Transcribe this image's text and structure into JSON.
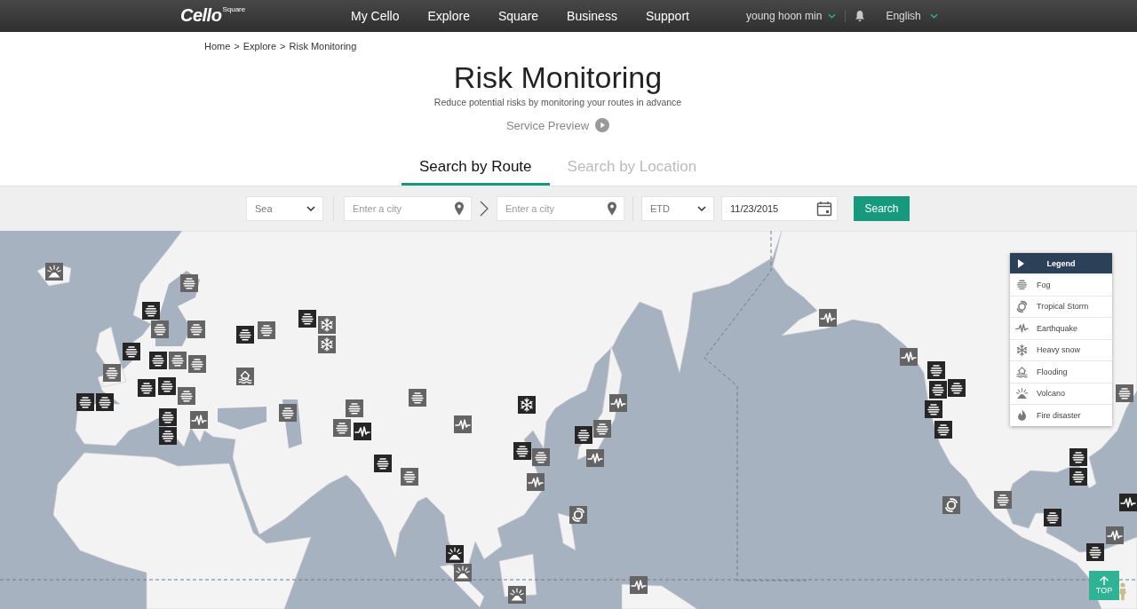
{
  "nav": {
    "logo": {
      "text": "Cello",
      "superscript": "Square"
    },
    "menu": [
      "My Cello",
      "Explore",
      "Square",
      "Business",
      "Support"
    ],
    "user": "young hoon min",
    "language": "English"
  },
  "breadcrumb": {
    "items": [
      "Home",
      "Explore",
      "Risk Monitoring"
    ],
    "separator": ">"
  },
  "header": {
    "title": "Risk Monitoring",
    "subtitle": "Reduce potential risks by monitoring your routes in advance",
    "preview_link": "Service Preview"
  },
  "tabs": [
    {
      "label": "Search by Route",
      "selected": true
    },
    {
      "label": "Search by Location",
      "selected": false
    }
  ],
  "search": {
    "transport": {
      "value": "Sea"
    },
    "origin": {
      "placeholder": "Enter a city"
    },
    "destination": {
      "placeholder": "Enter a city"
    },
    "date_type": {
      "value": "ETD"
    },
    "date": {
      "value": "11/23/2015"
    },
    "button": "Search"
  },
  "map": {
    "legend": {
      "title": "Legend",
      "items": [
        {
          "kind": "fog",
          "label": "Fog"
        },
        {
          "kind": "storm",
          "label": "Tropical Storm"
        },
        {
          "kind": "earthquake",
          "label": "Earthquake"
        },
        {
          "kind": "snow",
          "label": "Heavy snow"
        },
        {
          "kind": "flood",
          "label": "Flooding"
        },
        {
          "kind": "volcano",
          "label": "Volcano"
        },
        {
          "kind": "fire",
          "label": "Fire disaster"
        }
      ]
    },
    "markers": [
      {
        "kind": "volcano",
        "color": "#646464"
      },
      {
        "kind": "fog",
        "color": "#646464"
      },
      {
        "kind": "fog",
        "color": "#262626"
      },
      {
        "kind": "fog",
        "color": "#646464"
      },
      {
        "kind": "fog",
        "color": "#262626"
      },
      {
        "kind": "fog",
        "color": "#646464"
      },
      {
        "kind": "fog",
        "color": "#262626"
      },
      {
        "kind": "fog",
        "color": "#646464"
      },
      {
        "kind": "fog",
        "color": "#646464"
      },
      {
        "kind": "fog",
        "color": "#646464"
      },
      {
        "kind": "fog",
        "color": "#262626"
      },
      {
        "kind": "fog",
        "color": "#262626"
      },
      {
        "kind": "fog",
        "color": "#646464"
      },
      {
        "kind": "fog",
        "color": "#262626"
      },
      {
        "kind": "fog",
        "color": "#262626"
      },
      {
        "kind": "fog",
        "color": "#262626"
      },
      {
        "kind": "fog",
        "color": "#262626"
      },
      {
        "kind": "earthquake",
        "color": "#646464"
      },
      {
        "kind": "fog",
        "color": "#262626"
      },
      {
        "kind": "fog",
        "color": "#646464"
      },
      {
        "kind": "fog",
        "color": "#262626"
      },
      {
        "kind": "snow",
        "color": "#646464"
      },
      {
        "kind": "snow",
        "color": "#646464"
      },
      {
        "kind": "flood",
        "color": "#646464"
      },
      {
        "kind": "fog",
        "color": "#646464"
      },
      {
        "kind": "fog",
        "color": "#646464"
      },
      {
        "kind": "fog",
        "color": "#646464"
      },
      {
        "kind": "earthquake",
        "color": "#262626"
      },
      {
        "kind": "fog",
        "color": "#262626"
      },
      {
        "kind": "fog",
        "color": "#646464"
      },
      {
        "kind": "fog",
        "color": "#646464"
      },
      {
        "kind": "earthquake",
        "color": "#646464"
      },
      {
        "kind": "snow",
        "color": "#262626"
      },
      {
        "kind": "fog",
        "color": "#262626"
      },
      {
        "kind": "fog",
        "color": "#646464"
      },
      {
        "kind": "earthquake",
        "color": "#646464"
      },
      {
        "kind": "fog",
        "color": "#262626"
      },
      {
        "kind": "fog",
        "color": "#646464"
      },
      {
        "kind": "earthquake",
        "color": "#646464"
      },
      {
        "kind": "earthquake",
        "color": "#646464"
      },
      {
        "kind": "storm",
        "color": "#646464"
      },
      {
        "kind": "volcano",
        "color": "#262626"
      },
      {
        "kind": "volcano",
        "color": "#646464"
      },
      {
        "kind": "volcano",
        "color": "#646464"
      },
      {
        "kind": "earthquake",
        "color": "#646464"
      },
      {
        "kind": "earthquake",
        "color": "#646464"
      },
      {
        "kind": "earthquake",
        "color": "#646464"
      },
      {
        "kind": "fog",
        "color": "#262626"
      },
      {
        "kind": "fog",
        "color": "#262626"
      },
      {
        "kind": "fog",
        "color": "#262626"
      },
      {
        "kind": "fog",
        "color": "#262626"
      },
      {
        "kind": "fog",
        "color": "#262626"
      },
      {
        "kind": "storm",
        "color": "#646464"
      },
      {
        "kind": "fog",
        "color": "#646464"
      },
      {
        "kind": "fog",
        "color": "#262626"
      },
      {
        "kind": "fog",
        "color": "#262626"
      },
      {
        "kind": "fog",
        "color": "#646464"
      },
      {
        "kind": "fog",
        "color": "#262626"
      },
      {
        "kind": "earthquake",
        "color": "#262626"
      },
      {
        "kind": "earthquake",
        "color": "#646464"
      },
      {
        "kind": "fog",
        "color": "#262626"
      }
    ],
    "top_button": "TOP"
  }
}
